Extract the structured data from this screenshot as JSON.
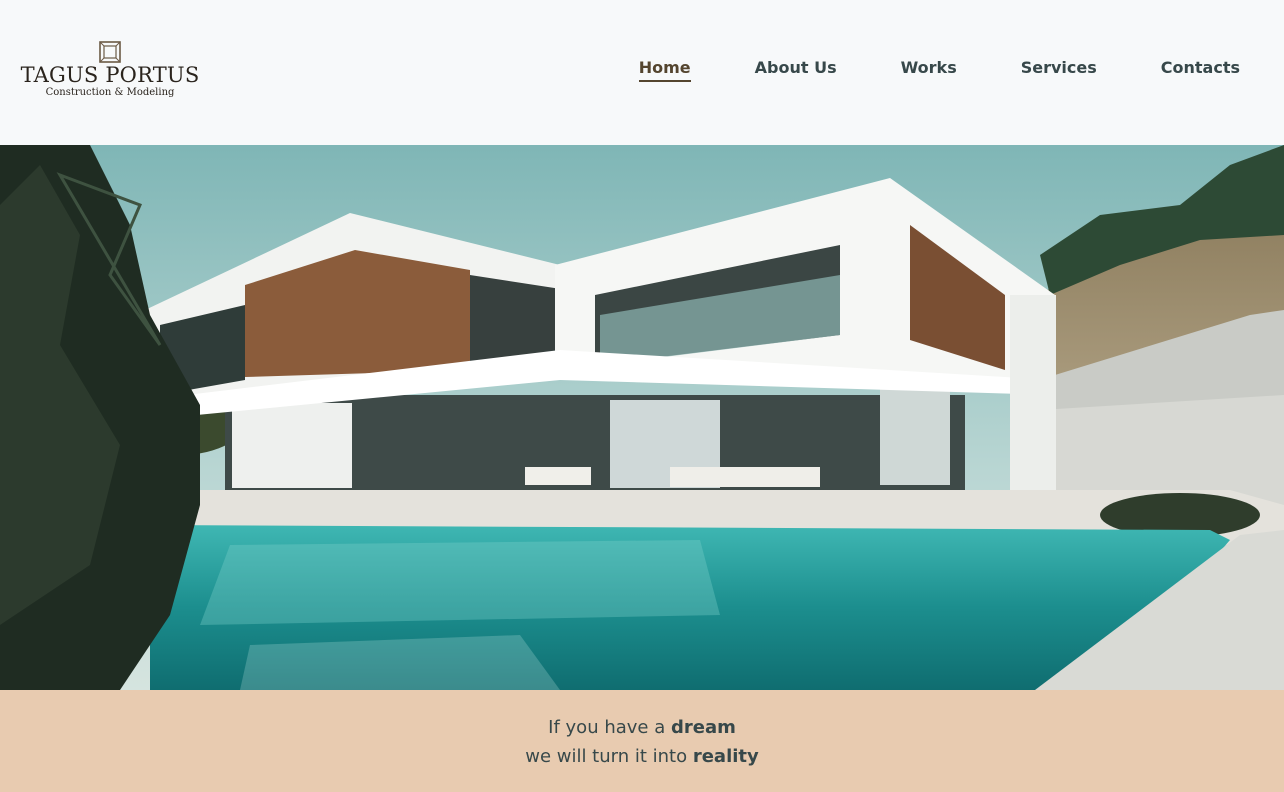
{
  "brand": {
    "name": "TAGUS PORTUS",
    "tagline": "Construction & Modeling"
  },
  "nav": {
    "items": [
      {
        "label": "Home",
        "active": true
      },
      {
        "label": "About Us",
        "active": false
      },
      {
        "label": "Works",
        "active": false
      },
      {
        "label": "Services",
        "active": false
      },
      {
        "label": "Contacts",
        "active": false
      }
    ]
  },
  "hero": {
    "image": "modern-villa-with-pool"
  },
  "banner": {
    "line1_text": "If you have a ",
    "line1_bold": "dream",
    "line2_text": "we will turn it into ",
    "line2_bold": "reality"
  },
  "colors": {
    "header_bg": "#f7f9fa",
    "nav_text": "#37484a",
    "nav_active": "#54452f",
    "banner_bg": "#e8cbb0"
  }
}
